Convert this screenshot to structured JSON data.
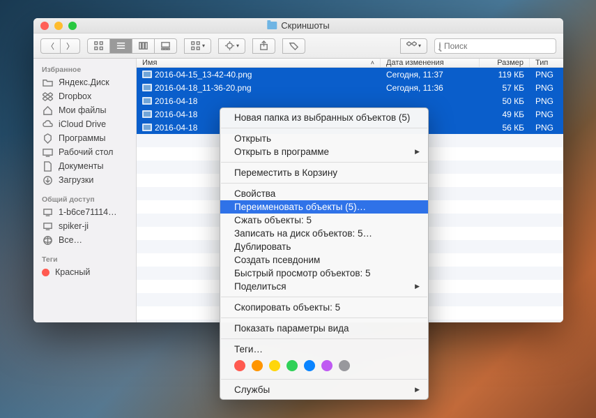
{
  "window": {
    "title": "Скриншоты"
  },
  "toolbar": {
    "search_placeholder": "Поиск"
  },
  "sidebar": {
    "section_favorites": "Избранное",
    "favorites": [
      {
        "label": "Яндекс.Диск",
        "icon": "folder"
      },
      {
        "label": "Dropbox",
        "icon": "dropbox"
      },
      {
        "label": "Мои файлы",
        "icon": "home"
      },
      {
        "label": "iCloud Drive",
        "icon": "cloud"
      },
      {
        "label": "Программы",
        "icon": "apps"
      },
      {
        "label": "Рабочий стол",
        "icon": "desktop"
      },
      {
        "label": "Документы",
        "icon": "doc"
      },
      {
        "label": "Загрузки",
        "icon": "download"
      }
    ],
    "section_shared": "Общий доступ",
    "shared": [
      {
        "label": "1-b6ce71114…"
      },
      {
        "label": "spiker-ji"
      },
      {
        "label": "Все…"
      }
    ],
    "section_tags": "Теги",
    "tags": [
      {
        "label": "Красный",
        "color": "red"
      }
    ]
  },
  "headers": {
    "name": "Имя",
    "date": "Дата изменения",
    "size": "Размер",
    "type": "Тип"
  },
  "files": [
    {
      "name": "2016-04-15_13-42-40.png",
      "date": "Сегодня, 11:37",
      "size": "119 КБ",
      "type": "PNG"
    },
    {
      "name": "2016-04-18_11-36-20.png",
      "date": "Сегодня, 11:36",
      "size": "57 КБ",
      "type": "PNG"
    },
    {
      "name": "2016-04-18",
      "date": "",
      "size": "50 КБ",
      "type": "PNG"
    },
    {
      "name": "2016-04-18",
      "date": "",
      "size": "49 КБ",
      "type": "PNG"
    },
    {
      "name": "2016-04-18",
      "date": "",
      "size": "56 КБ",
      "type": "PNG"
    }
  ],
  "contextmenu": {
    "new_folder": "Новая папка из выбранных объектов (5)",
    "open": "Открыть",
    "open_with": "Открыть в программе",
    "trash": "Переместить в Корзину",
    "info": "Свойства",
    "rename": "Переименовать объекты (5)…",
    "compress": "Сжать объекты: 5",
    "burn": "Записать на диск объектов: 5…",
    "duplicate": "Дублировать",
    "alias": "Создать псевдоним",
    "quicklook": "Быстрый просмотр объектов: 5",
    "share": "Поделиться",
    "copy": "Скопировать объекты: 5",
    "viewopts": "Показать параметры вида",
    "tags_label": "Теги…",
    "services": "Службы"
  }
}
